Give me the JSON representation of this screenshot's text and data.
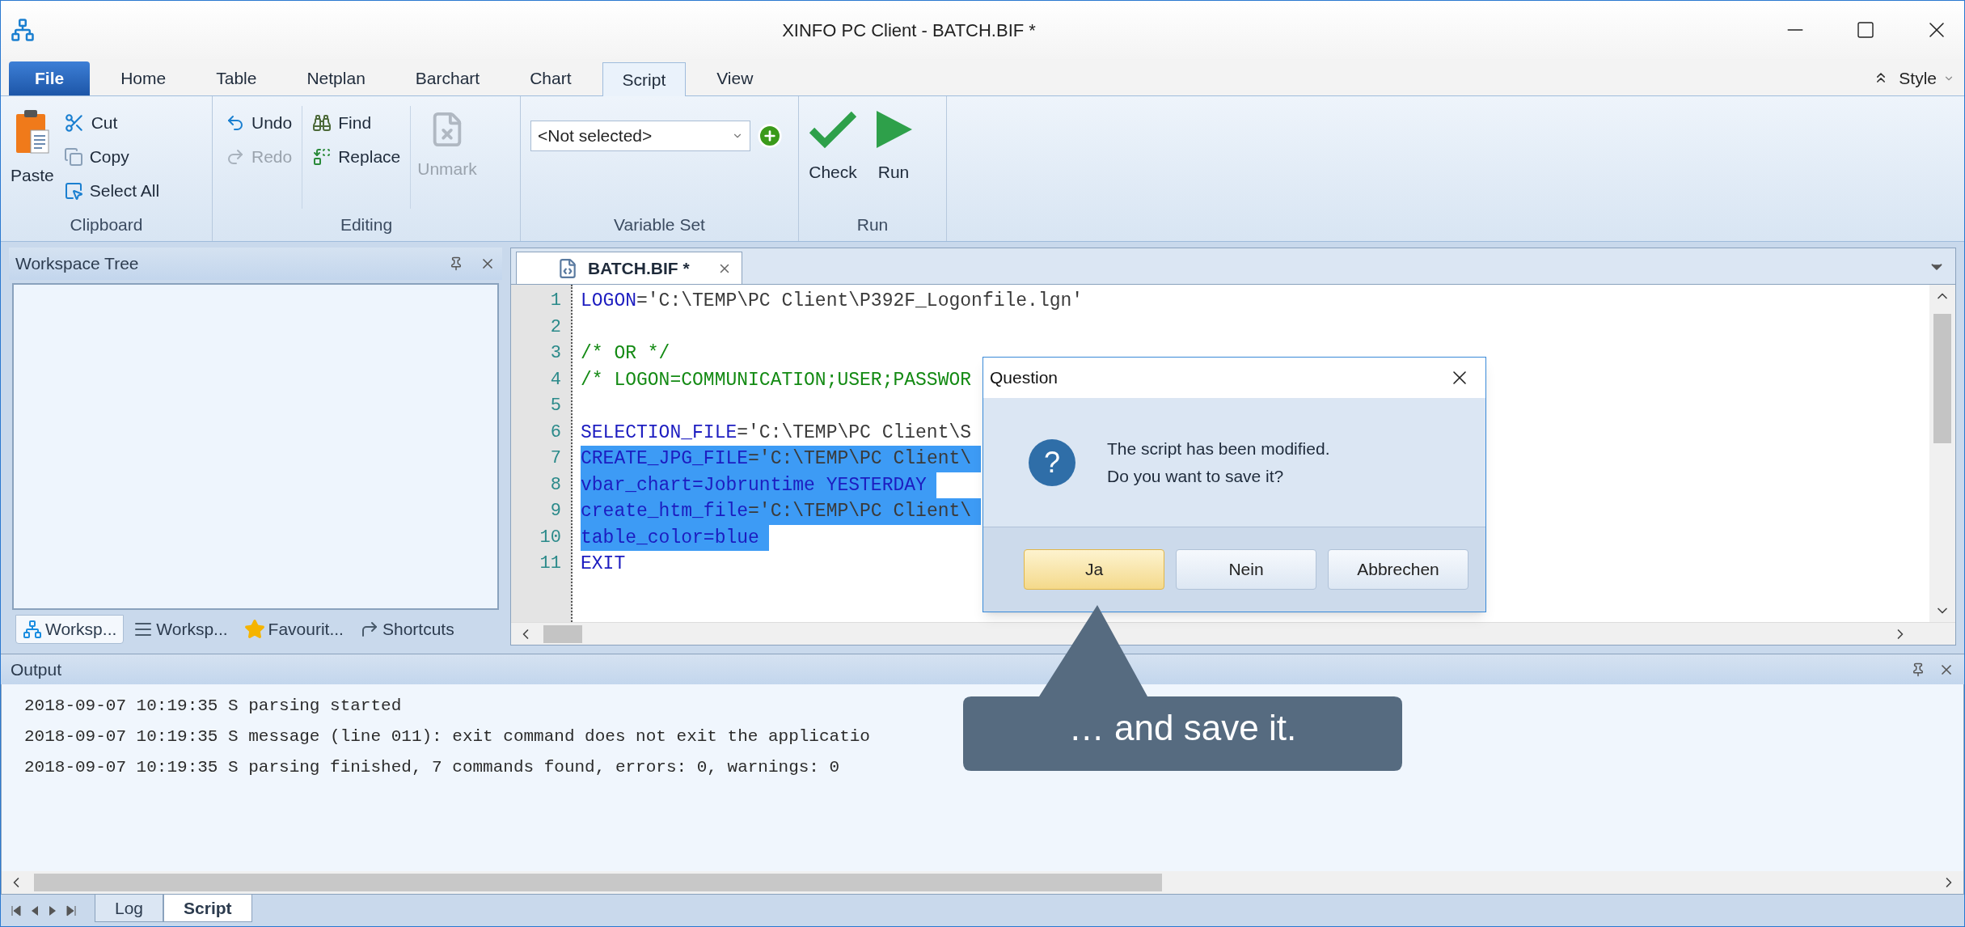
{
  "window": {
    "title": "XINFO PC Client - BATCH.BIF *"
  },
  "ribbon_tabs": [
    {
      "label": "File",
      "kind": "file",
      "selected": false
    },
    {
      "label": "Home",
      "kind": "tab",
      "selected": false
    },
    {
      "label": "Table",
      "kind": "tab",
      "selected": false
    },
    {
      "label": "Netplan",
      "kind": "tab",
      "selected": false
    },
    {
      "label": "Barchart",
      "kind": "tab",
      "selected": false
    },
    {
      "label": "Chart",
      "kind": "tab",
      "selected": false
    },
    {
      "label": "Script",
      "kind": "tab",
      "selected": true
    },
    {
      "label": "View",
      "kind": "tab",
      "selected": false
    }
  ],
  "style_menu": {
    "label": "Style"
  },
  "clipboard": {
    "label": "Clipboard",
    "paste": "Paste",
    "cut": "Cut",
    "copy": "Copy",
    "select_all": "Select All"
  },
  "editing": {
    "label": "Editing",
    "undo": {
      "label": "Undo",
      "disabled": false
    },
    "redo": {
      "label": "Redo",
      "disabled": true
    },
    "find": "Find",
    "replace": "Replace",
    "unmark": {
      "label": "Unmark",
      "disabled": true
    }
  },
  "variable_set": {
    "label": "Variable Set",
    "value": "<Not selected>"
  },
  "run_group": {
    "label": "Run",
    "check": "Check",
    "run": "Run"
  },
  "workspace_panel": {
    "title": "Workspace Tree",
    "tabs": [
      {
        "label": "Worksp...",
        "selected": true
      },
      {
        "label": "Worksp...",
        "selected": false
      },
      {
        "label": "Favourit...",
        "selected": false
      },
      {
        "label": "Shortcuts",
        "selected": false
      }
    ]
  },
  "editor": {
    "tab": {
      "label": "BATCH.BIF *",
      "selected": true
    },
    "lines": [
      {
        "number": "1",
        "selected": false,
        "segments": [
          {
            "text": "LOGON",
            "kind": "keyword"
          },
          {
            "text": "='C:\\TEMP\\PC Client\\P392F_Logonfile.lgn'",
            "kind": "string"
          }
        ]
      },
      {
        "number": "2"
      },
      {
        "number": "3",
        "selected": false,
        "segments": [
          {
            "text": "/* OR */",
            "kind": "comment"
          }
        ]
      },
      {
        "number": "4",
        "selected": false,
        "segments": [
          {
            "text": "/* LOGON=COMMUNICATION;USER;PASSWOR",
            "kind": "comment"
          }
        ]
      },
      {
        "number": "5"
      },
      {
        "number": "6",
        "selected": false,
        "segments": [
          {
            "text": "SELECTION_FILE",
            "kind": "keyword"
          },
          {
            "text": "='C:\\TEMP\\PC Client\\S",
            "kind": "string"
          }
        ]
      },
      {
        "number": "7",
        "selected": true,
        "segments": [
          {
            "text": "CREATE_JPG_FILE",
            "kind": "keyword"
          },
          {
            "text": "='C:\\TEMP\\PC Client\\",
            "kind": "string"
          }
        ]
      },
      {
        "number": "8",
        "selected": true,
        "segments": [
          {
            "text": "vbar_chart=Jobruntime YESTERDAY",
            "kind": "keyword"
          }
        ]
      },
      {
        "number": "9",
        "selected": true,
        "segments": [
          {
            "text": "create_htm_file",
            "kind": "keyword"
          },
          {
            "text": "='C:\\TEMP\\PC Client\\",
            "kind": "string"
          }
        ]
      },
      {
        "number": "10",
        "selected": true,
        "segments": [
          {
            "text": "table_color=blue",
            "kind": "keyword"
          }
        ]
      },
      {
        "number": "11",
        "selected": false,
        "segments": [
          {
            "text": "EXIT",
            "kind": "keyword"
          }
        ]
      }
    ]
  },
  "output": {
    "title": "Output",
    "lines": [
      "2018-09-07 10:19:35 S parsing started",
      "2018-09-07 10:19:35 S message (line 011): exit command does not exit the applicatio",
      "2018-09-07 10:19:35 S parsing finished, 7 commands found, errors: 0, warnings: 0"
    ]
  },
  "bottom_tabs": [
    {
      "label": "Log",
      "selected": false
    },
    {
      "label": "Script",
      "selected": true
    }
  ],
  "dialog": {
    "title": "Question",
    "icon_glyph": "?",
    "message": "The script has been modified.\nDo you want to save it?",
    "buttons": [
      {
        "label": "Ja",
        "default": true
      },
      {
        "label": "Nein",
        "default": false
      },
      {
        "label": "Abbrechen",
        "default": false
      }
    ]
  },
  "callout": {
    "text": "… and save it."
  }
}
